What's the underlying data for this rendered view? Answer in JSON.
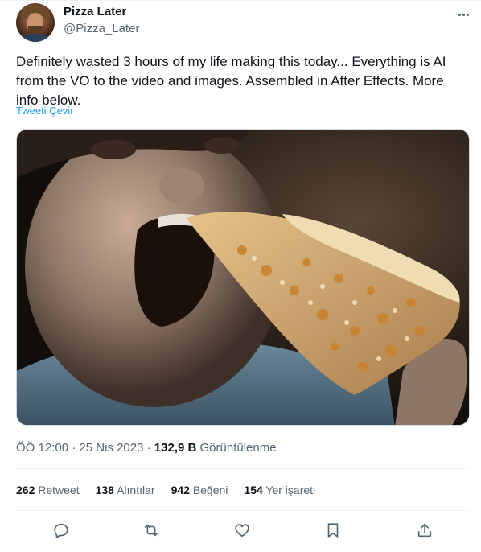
{
  "author": {
    "name": "Pizza Later",
    "handle": "@Pizza_Later"
  },
  "tweet": {
    "text": "Definitely wasted 3 hours of my life making this today... Everything is AI from the VO to the video and images. Assembled in After Effects. More info below.",
    "translate_label": "Tweeti Çevir",
    "time": "ÖÖ 12:00",
    "separator": "·",
    "date": "25 Nis 2023",
    "views_count": "132,9 B",
    "views_label": "Görüntülenme"
  },
  "stats": [
    {
      "count": "262",
      "label": "Retweet"
    },
    {
      "count": "138",
      "label": "Alıntılar"
    },
    {
      "count": "942",
      "label": "Beğeni"
    },
    {
      "count": "154",
      "label": "Yer işareti"
    }
  ],
  "actions": {
    "reply_icon": "reply-icon",
    "retweet_icon": "retweet-icon",
    "like_icon": "like-icon",
    "bookmark_icon": "bookmark-icon",
    "share_icon": "share-icon"
  },
  "colors": {
    "link": "#1d9bf0",
    "secondary_text": "#536471",
    "primary_text": "#0f1419",
    "divider": "#eff3f4"
  }
}
